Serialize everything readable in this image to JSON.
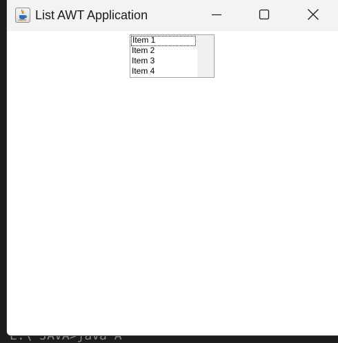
{
  "window": {
    "title": "List AWT Application",
    "icon": "java-cup-icon"
  },
  "caption_buttons": {
    "minimize": "minimize-icon",
    "maximize": "maximize-icon",
    "close": "close-icon"
  },
  "list": {
    "items": [
      "Item 1",
      "Item 2",
      "Item 3",
      "Item 4"
    ],
    "focused_index": 0
  },
  "background": {
    "terminal_text": "E:\\ JAVA>java A"
  },
  "colors": {
    "titlebar": "#f3f3f3",
    "content": "#ffffff",
    "scrollbar_track": "#f0f0f0"
  }
}
